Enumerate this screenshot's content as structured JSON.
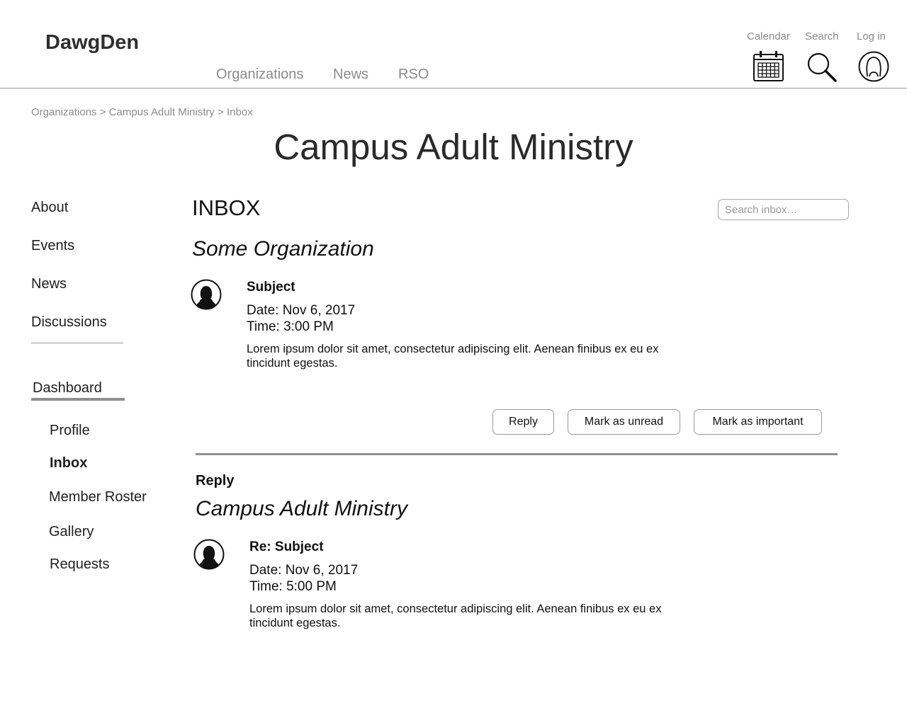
{
  "header": {
    "logo": "DawgDen",
    "nav": [
      "Organizations",
      "News",
      "RSO"
    ],
    "utilities": {
      "calendar": {
        "label": "Calendar",
        "icon": "calendar-icon"
      },
      "search": {
        "label": "Search",
        "icon": "search-icon"
      },
      "login": {
        "label": "Log in",
        "icon": "user-icon"
      }
    }
  },
  "breadcrumb": {
    "items": [
      "Organizations",
      "Campus Adult Ministry",
      "Inbox"
    ],
    "separator": ">"
  },
  "page": {
    "title": "Campus Adult Ministry"
  },
  "sidebar": {
    "links": [
      "About",
      "Events",
      "News",
      "Discussions"
    ],
    "dashboard": {
      "label": "Dashboard",
      "items": [
        "Profile",
        "Inbox",
        "Member Roster",
        "Gallery",
        "Requests"
      ],
      "active": "Inbox"
    }
  },
  "inbox": {
    "title": "INBOX",
    "search_placeholder": "Search inbox…",
    "message": {
      "sender": "Some Organization",
      "subject": "Subject",
      "date": "Date: Nov 6, 2017",
      "time": "Time: 3:00 PM",
      "body": "Lorem ipsum dolor sit amet, consectetur adipiscing elit. Aenean finibus ex eu ex tincidunt egestas."
    },
    "actions": {
      "reply": "Reply",
      "mark_unread": "Mark as unread",
      "mark_important": "Mark as important"
    },
    "reply": {
      "heading": "Reply",
      "sender": "Campus Adult Ministry",
      "subject": "Re: Subject",
      "date": "Date: Nov 6, 2017",
      "time": "Time: 5:00 PM",
      "body": "Lorem ipsum dolor sit amet, consectetur adipiscing elit. Aenean finibus ex eu ex tincidunt egestas."
    }
  },
  "colors": {
    "muted_text": "#8c8c8c",
    "rule": "#9a9a9a",
    "dark_text": "#111111"
  }
}
